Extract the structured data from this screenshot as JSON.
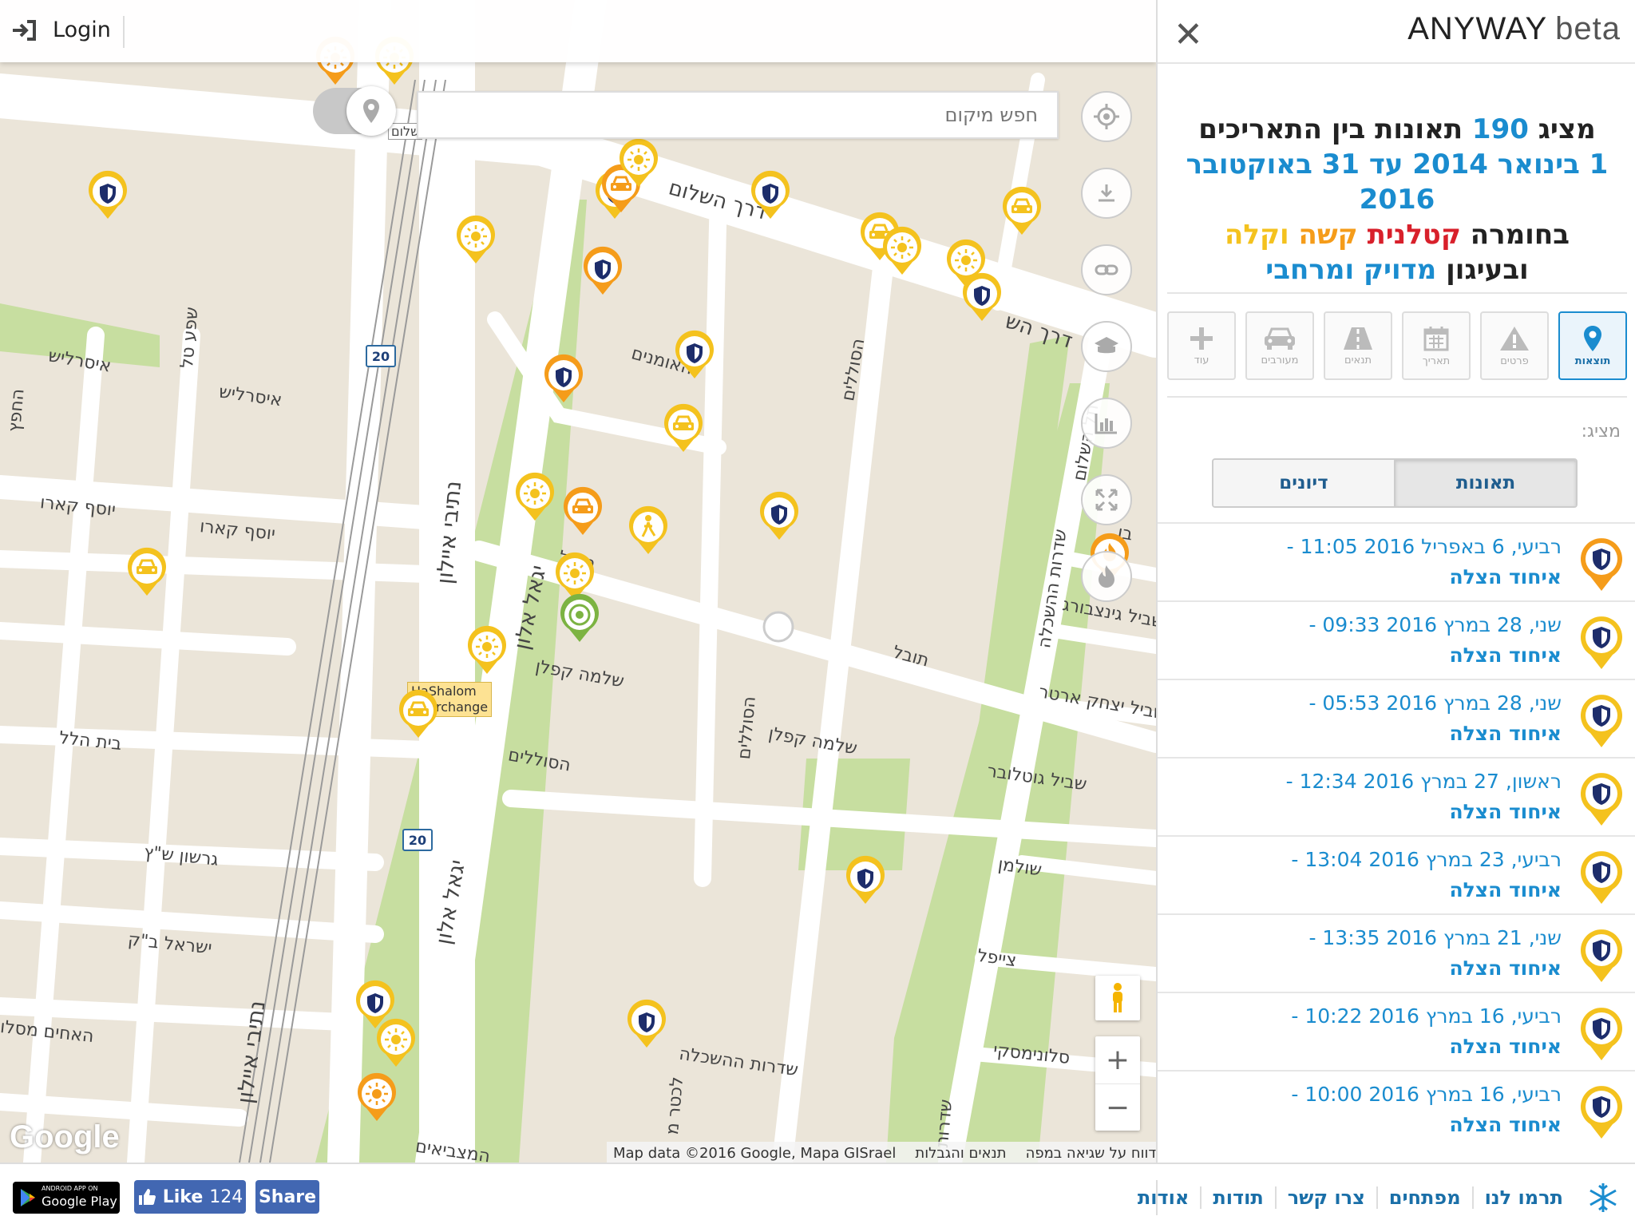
{
  "topbar": {
    "login_label": "Login",
    "login_icon": "sign-in-icon"
  },
  "search": {
    "placeholder": "חפש מיקום"
  },
  "map_controls": [
    "locate-icon",
    "download-icon",
    "link-icon",
    "layers-icon",
    "chart-icon",
    "expand-icon",
    "fire-icon"
  ],
  "map": {
    "google_logo": "Google",
    "attribution": {
      "data": "Map data ©2016 Google, Mapa GISrael",
      "terms": "תנאים והגבלות",
      "report": "דווח על שגיאה במפה"
    },
    "zoom_in": "+",
    "zoom_out": "−",
    "interchange": [
      "HaShalom",
      "Interchange"
    ],
    "route_shield": "20",
    "streets": {
      "derech_hashalom": "דרך השלום",
      "derech_hashalom2": "דרך הש",
      "ayalon1": "נתיבי איילון",
      "ayalon2": "נתיבי איילון",
      "yigal_alon": "יגאל אלון",
      "yigal_alon2": "יגאל אלון",
      "haumanim": "האומנים",
      "hasolelim1": "הסוללים",
      "hasolelim2": "הסוללים",
      "hasolelim3": "הסוללים",
      "tovel1": "תובל",
      "tovel2": "תובל",
      "shlomo_kaplan1": "שלמה קפלן",
      "shlomo_kaplan2": "שלמה קפלן",
      "isserles1": "איסרליש",
      "isserles2": "איסרליש",
      "yosef_karo1": "יוסף קארו",
      "yosef_karo2": "יוסף קארו",
      "beit_hillel": "בית הלל",
      "gershon": "גרשון ש\"ץ",
      "israel_bak": "ישראל ב\"ק",
      "haahim": "האחים מסלו",
      "shefa_tal": "שפע טל",
      "hachafetz": "החפץ",
      "hahaskala1": "שדרות ההשכלה",
      "hahaskala2": "שדרות ההשכלה",
      "sderot": "שדרות",
      "shulman": "שולמן",
      "zeifel": "צייפל",
      "slonimski": "סלונימסקי",
      "gotlober": "שביל גוטלובר",
      "erter": "שביל יצחק ארטר",
      "ginzburg": "שביל גינצבורג",
      "ben": "בן",
      "tel_hashalom": "תל השלום",
      "hashalom_tag": "שלום",
      "hamatzbiim": "המצביאים",
      "lechter": "לכטר מ"
    }
  },
  "sidebar": {
    "logo_main": "ANYWAY",
    "logo_beta": "beta",
    "headline": {
      "l1a": "מציג",
      "count": "190",
      "l1b": "תאונות בין התאריכים",
      "dates": "1 בינואר 2014 עד 31 באוקטובר 2016",
      "l3a": "בחומרה",
      "fatal": "קטלנית",
      "severe": "קשה",
      "light": "וקלה",
      "l4a": "ובעיגון",
      "accuracy": "מדויק ומרחבי"
    },
    "tabs": [
      {
        "label": "תוצאות",
        "icon": "map-pin-icon",
        "active": true
      },
      {
        "label": "פרטים",
        "icon": "warning-icon",
        "active": false
      },
      {
        "label": "תאריך",
        "icon": "calendar-icon",
        "active": false
      },
      {
        "label": "תנאים",
        "icon": "road-icon",
        "active": false
      },
      {
        "label": "מעורבים",
        "icon": "car-icon",
        "active": false
      },
      {
        "label": "עוד",
        "icon": "plus-icon",
        "active": false
      }
    ],
    "showing_label": "מציג:",
    "segment": {
      "accidents": "תאונות",
      "discussions": "דיונים"
    },
    "items": [
      {
        "title": "רביעי, 6 באפריל 2016 11:05 -",
        "source": "איחוד הצלה",
        "marker": "orange"
      },
      {
        "title": "שני, 28 במרץ 2016 09:33 -",
        "source": "איחוד הצלה",
        "marker": "yellow"
      },
      {
        "title": "שני, 28 במרץ 2016 05:53 -",
        "source": "איחוד הצלה",
        "marker": "yellow"
      },
      {
        "title": "ראשון, 27 במרץ 2016 12:34 -",
        "source": "איחוד הצלה",
        "marker": "yellow"
      },
      {
        "title": "רביעי, 23 במרץ 2016 13:04 -",
        "source": "איחוד הצלה",
        "marker": "yellow"
      },
      {
        "title": "שני, 21 במרץ 2016 13:35 -",
        "source": "איחוד הצלה",
        "marker": "yellow"
      },
      {
        "title": "רביעי, 16 במרץ 2016 10:22 -",
        "source": "איחוד הצלה",
        "marker": "yellow"
      },
      {
        "title": "רביעי, 16 במרץ 2016 10:00 -",
        "source": "איחוד הצלה",
        "marker": "yellow"
      }
    ]
  },
  "footer": {
    "gplay_small": "ANDROID APP ON",
    "gplay_big": "Google Play",
    "like_label": "Like",
    "like_count": "124",
    "share_label": "Share",
    "links": [
      "תרמו לנו",
      "מפתחים",
      "צרו קשר",
      "תודות",
      "אודות"
    ]
  },
  "colors": {
    "brand_blue": "#1a8ccf",
    "fatal": "#d8202b",
    "severe": "#f59c1a",
    "light": "#f4c21e",
    "shield_navy": "#1d2d6b"
  }
}
